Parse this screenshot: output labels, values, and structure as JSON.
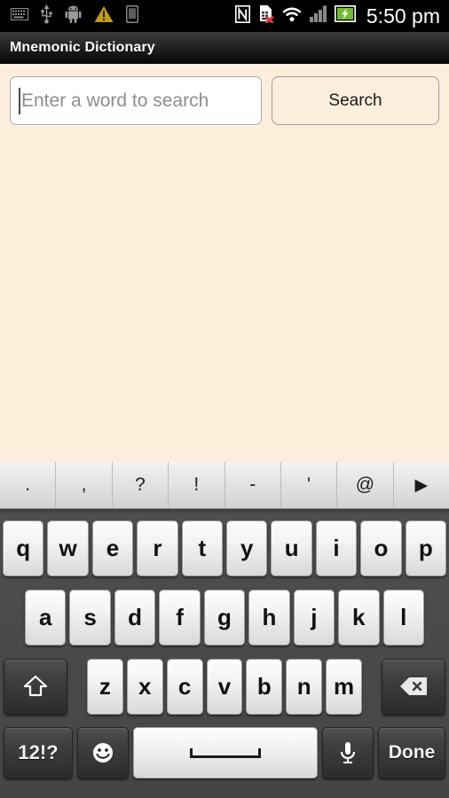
{
  "status_bar": {
    "left_icons": [
      {
        "name": "keyboard-icon",
        "glyph": "keyboard"
      },
      {
        "name": "usb-icon",
        "glyph": "usb"
      },
      {
        "name": "android-debug-icon",
        "glyph": "android"
      },
      {
        "name": "warning-icon",
        "glyph": "warning"
      },
      {
        "name": "device-icon",
        "glyph": "device"
      }
    ],
    "right_icons": [
      {
        "name": "nfc-icon",
        "glyph": "nfc"
      },
      {
        "name": "sim-card-missing-icon",
        "glyph": "sim-x"
      },
      {
        "name": "wifi-icon",
        "glyph": "wifi"
      },
      {
        "name": "cellular-signal-icon",
        "glyph": "signal"
      },
      {
        "name": "battery-charging-icon",
        "glyph": "battery"
      }
    ],
    "clock": "5:50 pm"
  },
  "title_bar": {
    "title": "Mnemonic Dictionary"
  },
  "content": {
    "search_placeholder": "Enter a word to search",
    "search_value": "",
    "search_button_label": "Search",
    "background_color": "#fdeedc"
  },
  "keyboard": {
    "punctuation_row": [
      {
        "label": ".",
        "name": "period-key"
      },
      {
        "label": ",",
        "name": "comma-key"
      },
      {
        "label": "?",
        "name": "question-key"
      },
      {
        "label": "!",
        "name": "exclamation-key"
      },
      {
        "label": "-",
        "name": "hyphen-key"
      },
      {
        "label": "'",
        "name": "apostrophe-key"
      },
      {
        "label": "@",
        "name": "at-key"
      },
      {
        "label": "▶",
        "name": "more-symbols-arrow-key"
      }
    ],
    "row1": [
      "q",
      "w",
      "e",
      "r",
      "t",
      "y",
      "u",
      "i",
      "o",
      "p"
    ],
    "row2": [
      "a",
      "s",
      "d",
      "f",
      "g",
      "h",
      "j",
      "k",
      "l"
    ],
    "row3_letters": [
      "z",
      "x",
      "c",
      "v",
      "b",
      "n",
      "m"
    ],
    "shift_label": "⇧",
    "backspace_label": "⌫",
    "symbols_label": "12!?",
    "emoji_label": "☺",
    "space_label": "",
    "mic_label": "mic",
    "done_label": "Done",
    "background_color": "#4b4b4b"
  }
}
